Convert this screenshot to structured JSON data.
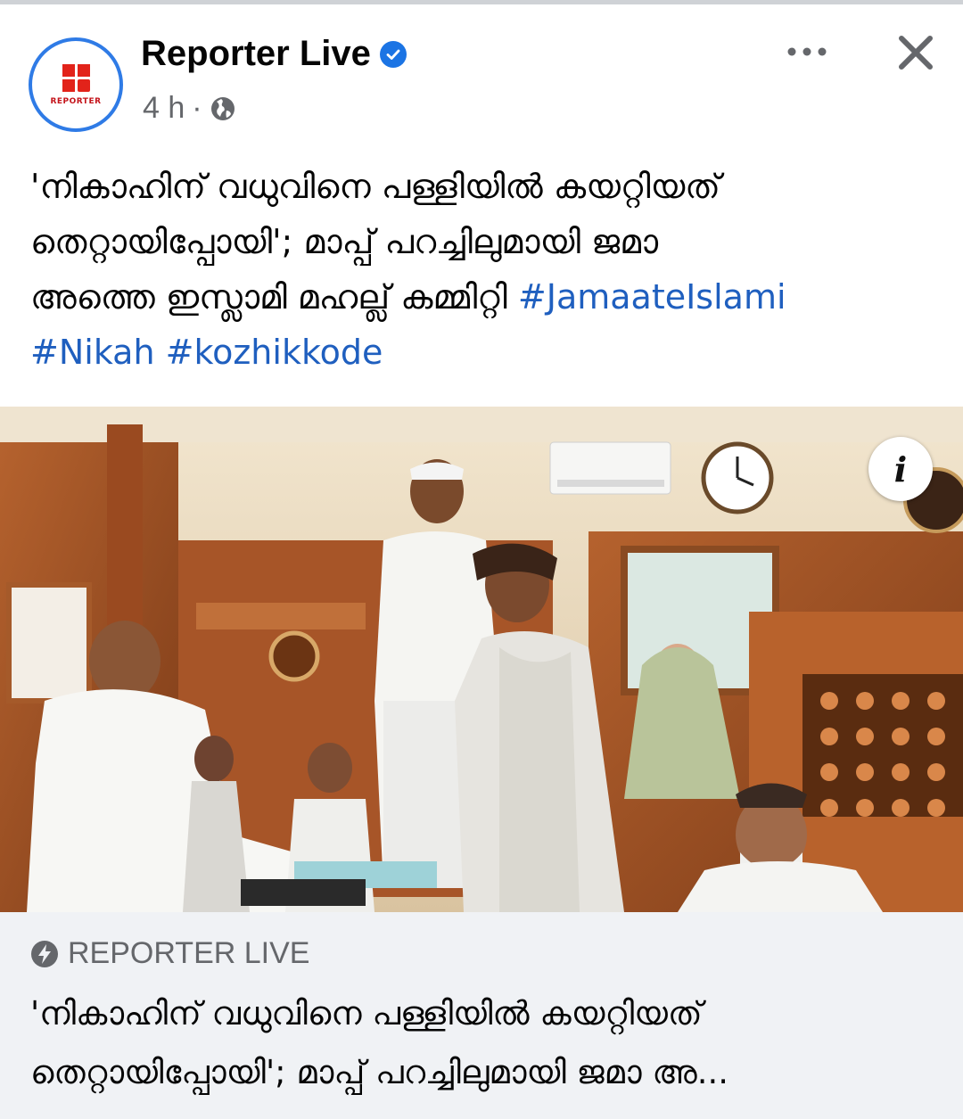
{
  "header": {
    "page_name": "Reporter Live",
    "time": "4 h",
    "separator": "·",
    "logo_text": "REPORTER",
    "icons": {
      "verified": "verified-badge-icon",
      "globe": "globe-icon",
      "more": "more-options-icon",
      "close": "close-icon"
    }
  },
  "post": {
    "caption_lines": [
      "'നികാഹിന് വധുവിനെ പള്ളിയിൽ കയറ്റിയത്",
      "തെറ്റായിപ്പോയി'; മാപ്പ് പറച്ചിലുമായി ജമാ",
      "അത്തെ ഇസ്ലാമി മഹല്ല് കമ്മിറ്റി "
    ],
    "hashtags": [
      "#JamaateIslami",
      "#Nikah",
      "#kozhikkode"
    ]
  },
  "photo": {
    "info_label": "i"
  },
  "link_preview": {
    "source": "REPORTER LIVE",
    "title_lines": [
      "'നികാഹിന് വധുവിനെ പള്ളിയിൽ കയറ്റിയത്",
      "തെറ്റായിപ്പോയി'; മാപ്പ് പറച്ചിലുമായി ജമാ അ..."
    ]
  },
  "colors": {
    "link": "#1f5fbf",
    "muted": "#65676b",
    "verified": "#1b74e4",
    "brand_red": "#e2231a"
  }
}
